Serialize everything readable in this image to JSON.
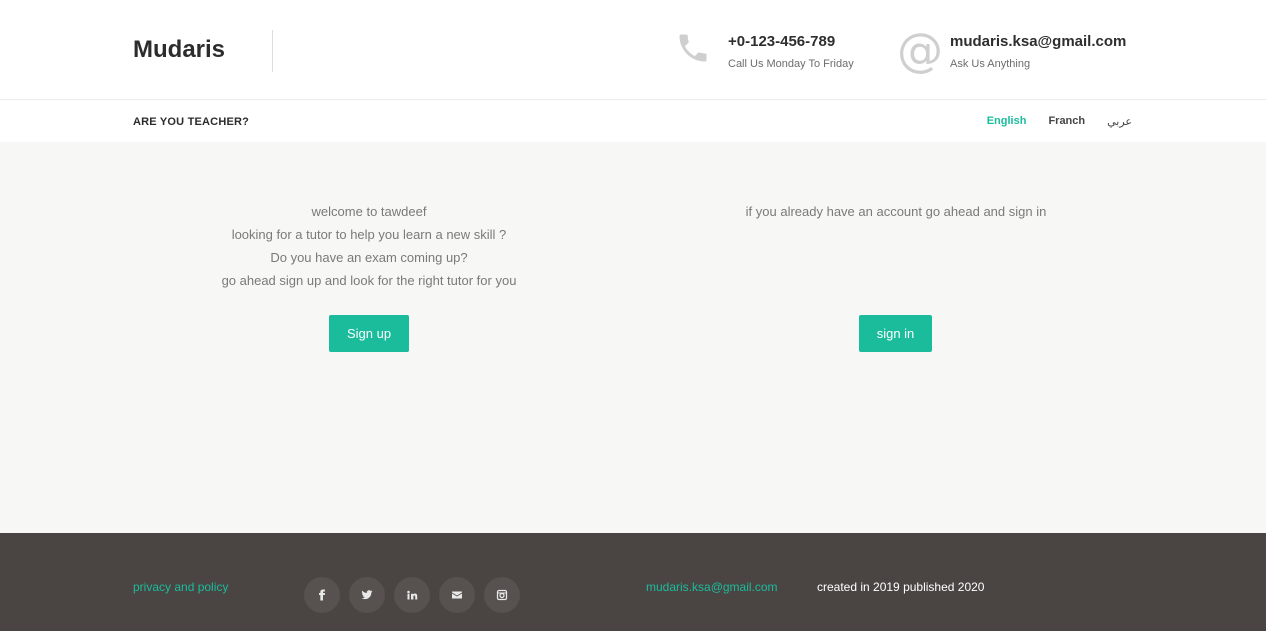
{
  "header": {
    "brand": "Mudaris",
    "phone": {
      "number": "+0-123-456-789",
      "note": "Call Us Monday To Friday",
      "icon": "phone-icon"
    },
    "email": {
      "address": "mudaris.ksa@gmail.com",
      "note": "Ask Us Anything",
      "icon": "at-icon"
    }
  },
  "nav": {
    "teacher_link": "ARE YOU TEACHER?",
    "languages": [
      "English",
      "Franch",
      "عربي"
    ],
    "active_language": "English"
  },
  "main": {
    "left": {
      "lines": [
        "welcome to tawdeef",
        "looking for a tutor to help you learn a new skill ?",
        "Do you have an exam coming up?",
        "go ahead sign up and look for the right tutor for you"
      ],
      "button": "Sign up"
    },
    "right": {
      "lines": [
        "if you already have an account go ahead and sign in"
      ],
      "button": "sign in"
    }
  },
  "footer": {
    "privacy": "privacy and policy",
    "socials": [
      "facebook-icon",
      "twitter-icon",
      "linkedin-icon",
      "envelope-icon",
      "instagram-icon"
    ],
    "email": "mudaris.ksa@gmail.com",
    "credit": "created in 2019 published 2020"
  },
  "colors": {
    "accent": "#1abc9c",
    "footer_bg": "#4a4543",
    "main_bg": "#f7f7f5"
  }
}
